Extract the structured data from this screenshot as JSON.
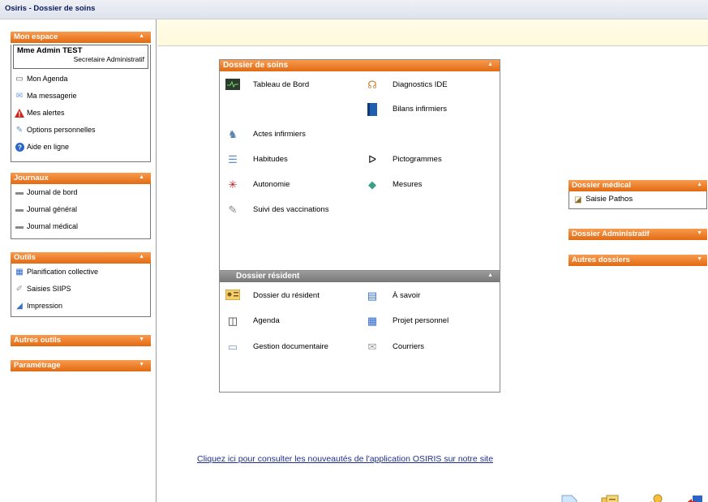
{
  "window": {
    "title": "Osiris - Dossier de soins"
  },
  "sidebar": {
    "mon_espace": {
      "title": "Mon espace",
      "user_name": "Mme Admin TEST",
      "user_role": "Secretaire Administratif",
      "items": [
        {
          "label": "Mon Agenda",
          "icon": "calendar-icon"
        },
        {
          "label": "Ma messagerie",
          "icon": "envelope-icon"
        },
        {
          "label": "Mes alertes",
          "icon": "alert-icon"
        },
        {
          "label": "Options personnelles",
          "icon": "settings-icon"
        },
        {
          "label": "Aide en ligne",
          "icon": "help-icon"
        }
      ]
    },
    "journaux": {
      "title": "Journaux",
      "items": [
        {
          "label": "Journal de bord",
          "icon": "journal-icon"
        },
        {
          "label": "Journal général",
          "icon": "journal-icon"
        },
        {
          "label": "Journal médical",
          "icon": "journal-icon"
        }
      ]
    },
    "outils": {
      "title": "Outils",
      "items": [
        {
          "label": "Planification collective",
          "icon": "grid-icon"
        },
        {
          "label": "Saisies SIIPS",
          "icon": "stamp-icon"
        },
        {
          "label": "Impression",
          "icon": "printer-icon"
        }
      ]
    },
    "autres_outils": {
      "title": "Autres outils"
    },
    "parametrage": {
      "title": "Paramétrage"
    }
  },
  "dossier_soins": {
    "title": "Dossier de soins",
    "items": {
      "tableau": "Tableau de Bord",
      "diagnostics": "Diagnostics IDE",
      "bilans": "Bilans infirmiers",
      "actes": "Actes infirmiers",
      "habitudes": "Habitudes",
      "pictogrammes": "Pictogrammes",
      "autonomie": "Autonomie",
      "mesures": "Mesures",
      "vaccinations": "Suivi des vaccinations"
    }
  },
  "dossier_resident": {
    "title": "Dossier résident",
    "items": {
      "dossier": "Dossier du résident",
      "asavoir": "À savoir",
      "agenda": "Agenda",
      "projet": "Projet personnel",
      "gestion": "Gestion documentaire",
      "courriers": "Courriers"
    }
  },
  "right": {
    "medical": {
      "title": "Dossier médical",
      "item": "Saisie Pathos"
    },
    "administratif": {
      "title": "Dossier Administratif"
    },
    "autres": {
      "title": "Autres dossiers"
    }
  },
  "footer": {
    "link": "Cliquez ici pour consulter les nouveautés de l'application OSIRIS sur notre site"
  }
}
